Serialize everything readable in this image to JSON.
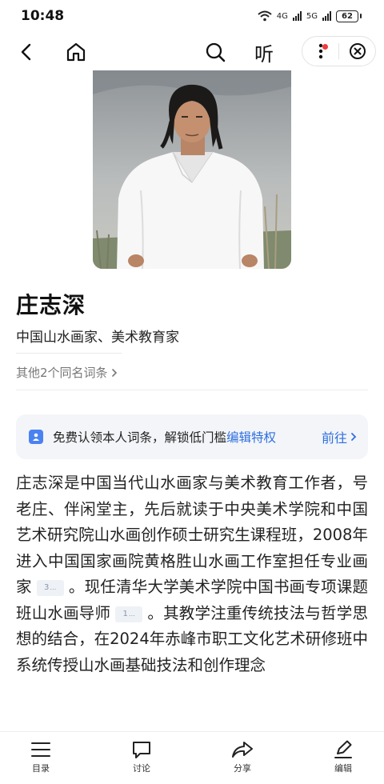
{
  "status_bar": {
    "time": "10:48",
    "network_1": "4G",
    "network_2": "5G",
    "battery": "62"
  },
  "nav": {
    "back_icon": "chevron-left-icon",
    "home_icon": "home-icon",
    "search_icon": "search-icon",
    "listen_label": "听",
    "more_icon": "more-vertical-icon",
    "close_icon": "close-circle-icon"
  },
  "entry": {
    "title": "庄志深",
    "subtitle": "中国山水画家、美术教育家",
    "homonym_link": "其他2个同名词条"
  },
  "claim_banner": {
    "text": "免费认领本人词条，解锁低门槛",
    "link": "编辑特权",
    "go": "前往"
  },
  "body": {
    "segment_1": "庄志深是中国当代山水画家与美术教育工作者，号老庄、伴闲堂主，先后就读于中央美术学院和中国艺术研究院山水画创作硕士研究生课程班，2008年进入中国国家画院黄格胜山水画工作室担任专业画家",
    "ref_1": "3",
    "segment_2": "。现任清华大学美术学院中国书画专项课题班山水画导师",
    "ref_2": "1",
    "segment_3": "。其教学注重传统技法与哲学思想的结合，在2024年赤峰市职工文化艺术研修班中系统传授山水画基础技法和创作理念"
  },
  "tab_bar": [
    {
      "label": "目录",
      "icon": "list-icon"
    },
    {
      "label": "讨论",
      "icon": "comment-icon"
    },
    {
      "label": "分享",
      "icon": "share-icon"
    },
    {
      "label": "编辑",
      "icon": "edit-icon"
    }
  ],
  "colors": {
    "accent": "#2f6fe0",
    "badge_red": "#f23a3a",
    "banner_bg": "#f3f5f8"
  }
}
